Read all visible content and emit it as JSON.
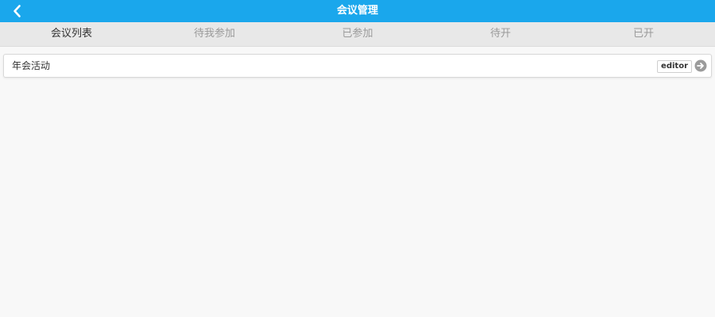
{
  "header": {
    "title": "会议管理",
    "back_icon": "chevron-left-icon",
    "background_color": "#1aa7ec"
  },
  "tabs": [
    {
      "label": "会议列表",
      "active": true
    },
    {
      "label": "待我参加",
      "active": false
    },
    {
      "label": "已参加",
      "active": false
    },
    {
      "label": "待开",
      "active": false
    },
    {
      "label": "已开",
      "active": false
    }
  ],
  "meetings": [
    {
      "title": "年会活动",
      "badge": "editor",
      "arrow_icon": "arrow-right-circle-icon"
    }
  ]
}
